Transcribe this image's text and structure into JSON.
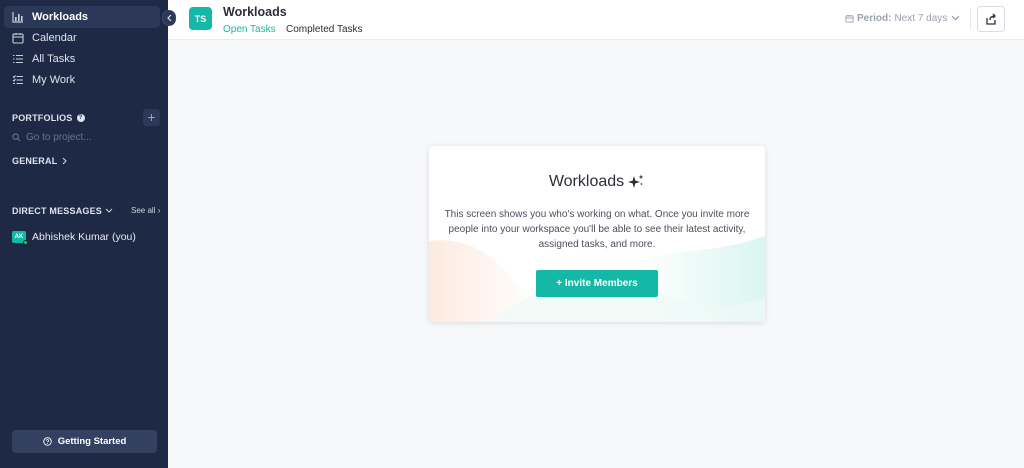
{
  "sidebar": {
    "nav": [
      {
        "label": "Workloads",
        "icon": "bar-chart-icon",
        "active": true
      },
      {
        "label": "Calendar",
        "icon": "calendar-icon",
        "active": false
      },
      {
        "label": "All Tasks",
        "icon": "list-icon",
        "active": false
      },
      {
        "label": "My Work",
        "icon": "checklist-icon",
        "active": false
      }
    ],
    "portfolios_label": "PORTFOLIOS",
    "project_search_placeholder": "Go to project...",
    "general_label": "GENERAL",
    "direct_messages_label": "DIRECT MESSAGES",
    "see_all_label": "See all",
    "dm_user": {
      "initials": "AK",
      "name": "Abhishek Kumar (you)"
    },
    "getting_started_label": "Getting Started"
  },
  "header": {
    "workspace_initials": "TS",
    "title": "Workloads",
    "tabs": [
      {
        "label": "Open Tasks",
        "active": true
      },
      {
        "label": "Completed Tasks",
        "active": false
      }
    ],
    "period_label": "Period:",
    "period_value": "Next 7 days"
  },
  "card": {
    "title": "Workloads",
    "description": "This screen shows you who's working on what. Once you invite more people into your workspace you'll be able to see their latest activity, assigned tasks, and more.",
    "button_label": "+ Invite Members"
  },
  "colors": {
    "sidebar_bg": "#1e2945",
    "accent": "#14b8a6",
    "page_bg": "#f7f8fa"
  }
}
